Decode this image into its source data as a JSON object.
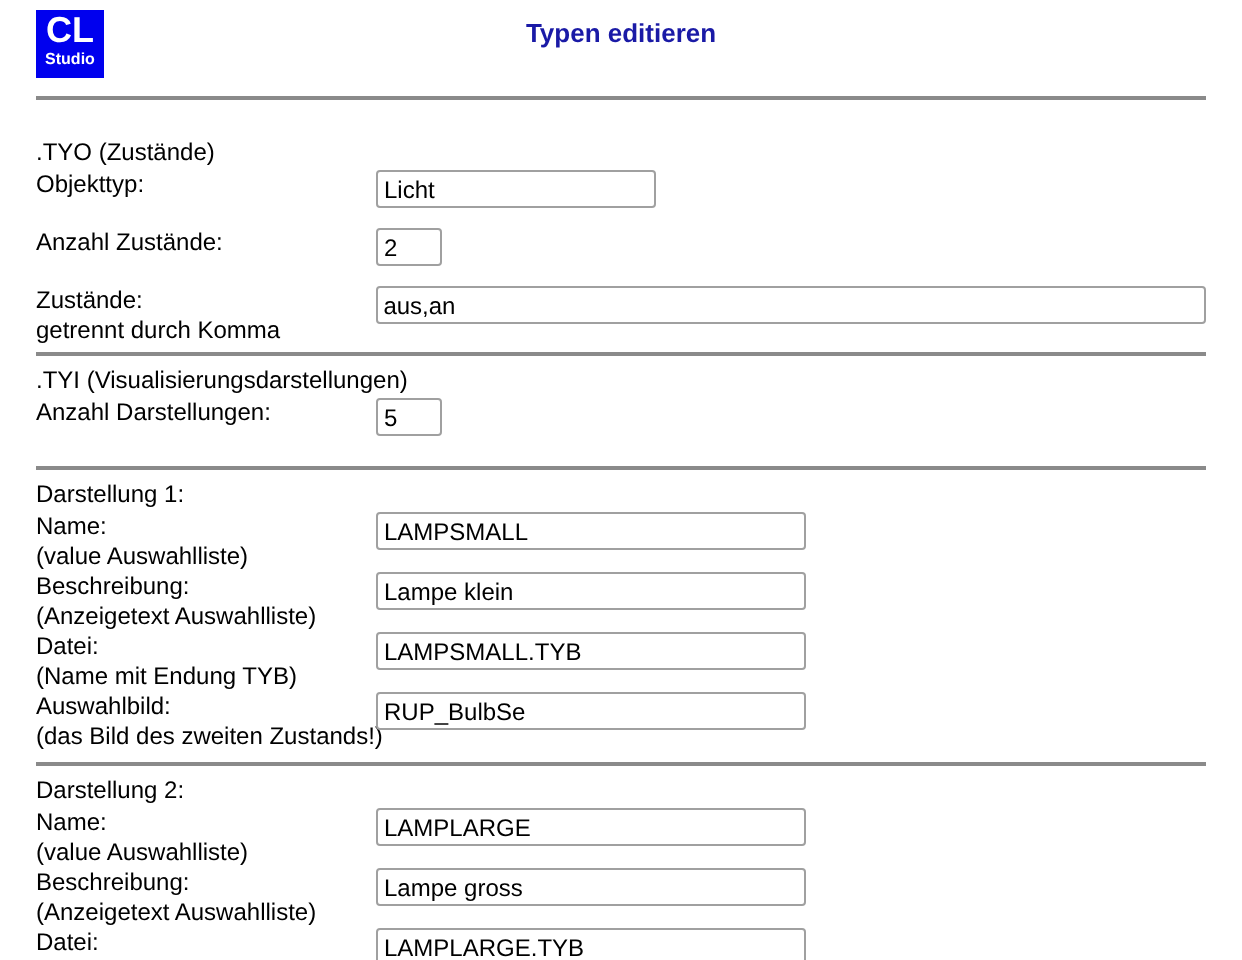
{
  "logo": {
    "line1": "CL",
    "line2": "Studio"
  },
  "title": "Typen editieren",
  "sections": [
    {
      "heading": ".TYO (Zustände)",
      "fields": [
        {
          "label": "Objekttyp:",
          "value": "Licht",
          "kind": "medium"
        },
        {
          "label": "Anzahl Zustände:",
          "value": "2",
          "kind": "count"
        },
        {
          "label": "Zustände:",
          "note": "getrennt durch Komma",
          "value": "aus,an",
          "kind": "wide"
        }
      ]
    },
    {
      "heading": ".TYI (Visualisierungsdarstellungen)",
      "fields": [
        {
          "label": "Anzahl Darstellungen:",
          "value": "5",
          "kind": "count"
        }
      ]
    },
    {
      "heading": "Darstellung 1:",
      "fields": [
        {
          "label": "Name:",
          "note": "(value Auswahlliste)",
          "value": "LAMPSMALL",
          "kind": "long"
        },
        {
          "label": "Beschreibung:",
          "note": "(Anzeigetext Auswahlliste)",
          "value": "Lampe klein",
          "kind": "long"
        },
        {
          "label": "Datei:",
          "note": "(Name mit Endung TYB)",
          "value": "LAMPSMALL.TYB",
          "kind": "long"
        },
        {
          "label": "Auswahlbild:",
          "note": "(das Bild des zweiten Zustands!)",
          "value": "RUP_BulbSe",
          "kind": "long"
        }
      ]
    },
    {
      "heading": "Darstellung 2:",
      "fields": [
        {
          "label": "Name:",
          "note": "(value Auswahlliste)",
          "value": "LAMPLARGE",
          "kind": "long"
        },
        {
          "label": "Beschreibung:",
          "note": "(Anzeigetext Auswahlliste)",
          "value": "Lampe gross",
          "kind": "long"
        },
        {
          "label": "Datei:",
          "value": "LAMPLARGE.TYB",
          "kind": "long"
        }
      ]
    }
  ]
}
